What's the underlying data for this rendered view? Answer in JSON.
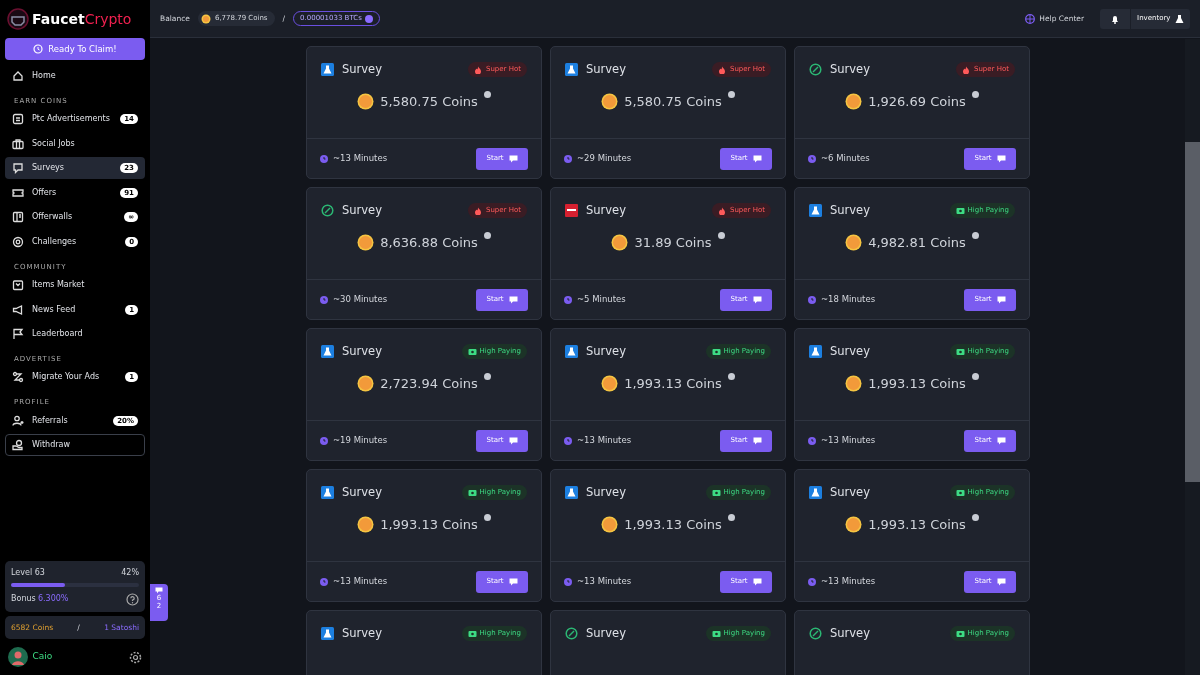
{
  "brand": {
    "part1": "Faucet",
    "part2": "Crypto"
  },
  "claim_button": "Ready To Claim!",
  "sidebar": {
    "items": [
      {
        "kind": "item",
        "label": "Home",
        "selected": false
      },
      {
        "kind": "header",
        "label": "EARN COINS"
      },
      {
        "kind": "item",
        "label": "Ptc Advertisements",
        "badge": "14",
        "selected": false
      },
      {
        "kind": "item",
        "label": "Social Jobs",
        "selected": false
      },
      {
        "kind": "item",
        "label": "Surveys",
        "badge": "23",
        "selected": true
      },
      {
        "kind": "item",
        "label": "Offers",
        "badge": "91",
        "selected": false
      },
      {
        "kind": "item",
        "label": "Offerwalls",
        "badge": "∞",
        "selected": false
      },
      {
        "kind": "item",
        "label": "Challenges",
        "badge": "0",
        "selected": false
      },
      {
        "kind": "header",
        "label": "COMMUNITY"
      },
      {
        "kind": "item",
        "label": "Items Market",
        "selected": false
      },
      {
        "kind": "item",
        "label": "News Feed",
        "badge": "1",
        "selected": false
      },
      {
        "kind": "item",
        "label": "Leaderboard",
        "selected": false
      },
      {
        "kind": "header",
        "label": "ADVERTISE"
      },
      {
        "kind": "item",
        "label": "Migrate Your Ads",
        "badge": "1",
        "selected": false
      },
      {
        "kind": "header",
        "label": "PROFILE"
      },
      {
        "kind": "item",
        "label": "Referrals",
        "badge": "20%",
        "selected": false
      },
      {
        "kind": "outlined",
        "label": "Withdraw",
        "selected": false
      }
    ]
  },
  "level_card": {
    "label": "Level 63",
    "percent": "42%",
    "level": 0.42,
    "bonus_label": "Bonus",
    "bonus_value": "6.300%"
  },
  "wallet": {
    "coins": "6582 Coins",
    "separator": "/",
    "satoshi": "1 Satoshi"
  },
  "user": {
    "name": "Caio"
  },
  "chat_tab": {
    "count": "62"
  },
  "topbar": {
    "balance_label": "Balance",
    "coins": "6,778.79 Coins",
    "separator": "/",
    "btc": "0.00001033 BTCs",
    "help": "Help Center",
    "inventory": "Inventory"
  },
  "surveys": [
    {
      "kind": "flask",
      "title": "Survey",
      "tag": {
        "kind": "hot",
        "label": "Super Hot"
      },
      "amount": "5,580.75 Coins",
      "duration": "~13 Minutes",
      "button": "Start"
    },
    {
      "kind": "flask",
      "title": "Survey",
      "tag": {
        "kind": "hot",
        "label": "Super Hot"
      },
      "amount": "5,580.75 Coins",
      "duration": "~29 Minutes",
      "button": "Start"
    },
    {
      "kind": "ring",
      "title": "Survey",
      "tag": {
        "kind": "hot",
        "label": "Super Hot"
      },
      "amount": "1,926.69 Coins",
      "duration": "~6 Minutes",
      "button": "Start"
    },
    {
      "kind": "ring",
      "title": "Survey",
      "tag": {
        "kind": "hot",
        "label": "Super Hot"
      },
      "amount": "8,636.88 Coins",
      "duration": "~30 Minutes",
      "button": "Start"
    },
    {
      "kind": "logo",
      "title": "Survey",
      "tag": {
        "kind": "hot",
        "label": "Super Hot"
      },
      "amount": "31.89 Coins",
      "duration": "~5 Minutes",
      "button": "Start"
    },
    {
      "kind": "flask",
      "title": "Survey",
      "tag": {
        "kind": "high",
        "label": "High Paying"
      },
      "amount": "4,982.81 Coins",
      "duration": "~18 Minutes",
      "button": "Start"
    },
    {
      "kind": "flask",
      "title": "Survey",
      "tag": {
        "kind": "high",
        "label": "High Paying"
      },
      "amount": "2,723.94 Coins",
      "duration": "~19 Minutes",
      "button": "Start"
    },
    {
      "kind": "flask",
      "title": "Survey",
      "tag": {
        "kind": "high",
        "label": "High Paying"
      },
      "amount": "1,993.13 Coins",
      "duration": "~13 Minutes",
      "button": "Start"
    },
    {
      "kind": "flask",
      "title": "Survey",
      "tag": {
        "kind": "high",
        "label": "High Paying"
      },
      "amount": "1,993.13 Coins",
      "duration": "~13 Minutes",
      "button": "Start"
    },
    {
      "kind": "flask",
      "title": "Survey",
      "tag": {
        "kind": "high",
        "label": "High Paying"
      },
      "amount": "1,993.13 Coins",
      "duration": "~13 Minutes",
      "button": "Start"
    },
    {
      "kind": "flask",
      "title": "Survey",
      "tag": {
        "kind": "high",
        "label": "High Paying"
      },
      "amount": "1,993.13 Coins",
      "duration": "~13 Minutes",
      "button": "Start"
    },
    {
      "kind": "flask",
      "title": "Survey",
      "tag": {
        "kind": "high",
        "label": "High Paying"
      },
      "amount": "1,993.13 Coins",
      "duration": "~13 Minutes",
      "button": "Start"
    },
    {
      "kind": "flask",
      "title": "Survey",
      "tag": {
        "kind": "high",
        "label": "High Paying"
      }
    },
    {
      "kind": "ring",
      "title": "Survey",
      "tag": {
        "kind": "high",
        "label": "High Paying"
      }
    },
    {
      "kind": "ring",
      "title": "Survey",
      "tag": {
        "kind": "high",
        "label": "High Paying"
      }
    }
  ]
}
